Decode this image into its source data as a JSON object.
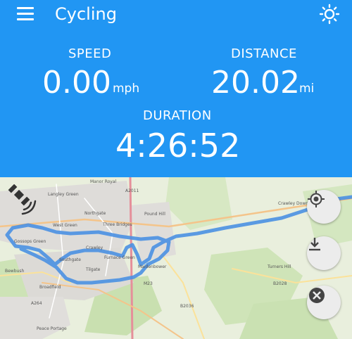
{
  "app": {
    "title": "Cycling"
  },
  "stats": {
    "speed": {
      "label": "SPEED",
      "value": "0.00",
      "unit": "mph"
    },
    "distance": {
      "label": "DISTANCE",
      "value": "20.02",
      "unit": "mi"
    },
    "duration": {
      "label": "DURATION",
      "value": "4:26:52"
    }
  },
  "map": {
    "place_labels": [
      "Manor Royal",
      "Langley Green",
      "Northgate",
      "Pound Hill",
      "Crawley Down",
      "West Green",
      "Three Bridges",
      "Gossops Green",
      "Crawley",
      "Southgate",
      "Furnace Green",
      "Maidenbower",
      "Tilgate",
      "Bewbush",
      "Broadfield",
      "Turners Hill",
      "Peace Portage",
      "A264",
      "M23",
      "A2011",
      "B2036",
      "B2028"
    ]
  },
  "icons": {
    "menu": "menu-icon",
    "brightness": "brightness-icon",
    "gps_signal": "satellite-icon",
    "my_location": "my-location-icon",
    "download": "download-icon",
    "no_location": "location-off-icon"
  },
  "colors": {
    "header": "#2196f3",
    "track": "#4a90e2",
    "fab_background": "#ececec"
  }
}
